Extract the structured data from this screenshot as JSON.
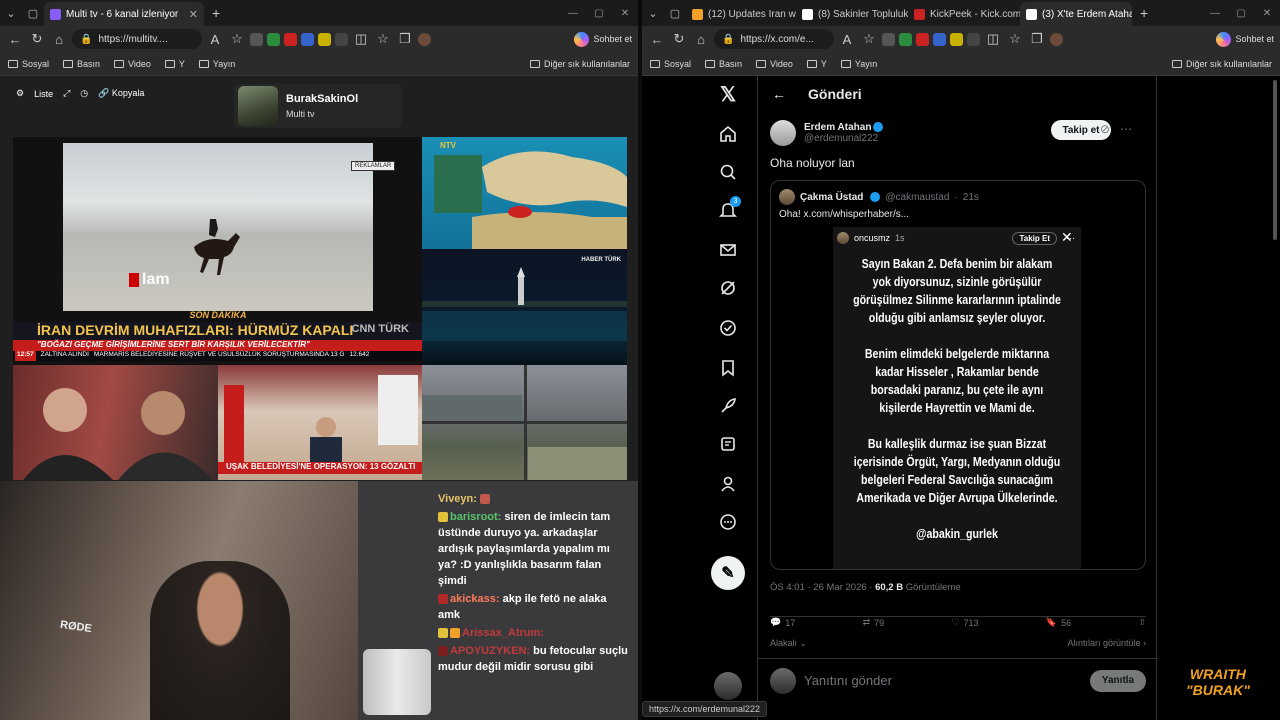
{
  "left_window": {
    "tabs": [
      {
        "label": "Multi tv - 6 kanal izleniyor",
        "active": true
      }
    ],
    "url": "https://multitv....",
    "copilot_label": "Sohbet et",
    "bookmarks": [
      "Sosyal",
      "Basın",
      "Video",
      "Y",
      "Yayın"
    ],
    "bookmarks_right": "Diğer sık kullanılanlar"
  },
  "right_window": {
    "tabs": [
      {
        "label": "(12) Updates Iran wa",
        "active": false
      },
      {
        "label": "(8) Sakinler Topluluk",
        "active": false
      },
      {
        "label": "KickPeek - Kick.com",
        "active": false
      },
      {
        "label": "(3) X'te Erdem Ataha",
        "active": true
      }
    ],
    "url": "https://x.com/e...",
    "copilot_label": "Sohbet et",
    "bookmarks": [
      "Sosyal",
      "Basın",
      "Video",
      "Y",
      "Yayın"
    ],
    "bookmarks_right": "Diğer sık kullanılanlar"
  },
  "multitv": {
    "toolbar": {
      "list": "Liste",
      "copy": "Kopyala"
    },
    "profile": {
      "name": "BurakSakinOl",
      "subtitle": "Multi tv"
    },
    "v1": {
      "ad_badge": "REKLAMLAR",
      "logo": "lam",
      "breaking": "SON DAKİKA",
      "headline": "İRAN DEVRİM MUHAFIZLARI: HÜRMÜZ KAPALI",
      "subhead": "\"BOĞAZI GEÇME GİRİŞİMLERİNE SERT BİR KARŞILIK VERİLECEKTİR\"",
      "time": "12:57",
      "ticker1": "ZALTINA ALINDI",
      "ticker2": "MARMARİS BELEDİYESİNE RÜŞVET VE USULSÜZLÜK SORUŞTURMASINDA 13 G",
      "ticker_value": "12.642",
      "channel": "CNN TÜRK"
    },
    "v2": {
      "channel": "NTV"
    },
    "v3": {
      "channel": "HABER TÜRK"
    },
    "v5": {
      "headline": "UŞAK BELEDİYESİ'NE OPERASYON: 13 GÖZALTI"
    }
  },
  "chat": {
    "messages": [
      {
        "user": "Viveyn:",
        "text": ""
      },
      {
        "user": "barisroot:",
        "text": "siren de imlecin tam üstünde duruyo ya. arkadaşlar ardışık paylaşımlarda yapalım mı ya? :D yanlışlıkla basarım falan şimdi"
      },
      {
        "user": "akickass:",
        "text": "akp ile fetö ne alaka amk"
      },
      {
        "user": "Arissax_Atrum:",
        "text": ""
      },
      {
        "user": "APOYUZYKEN:",
        "text": "bu fetocular suçlu mudur değil midir sorusu gibi"
      }
    ]
  },
  "webcam": {
    "mic_brand": "RØDE"
  },
  "x": {
    "header": "Gönderi",
    "author": {
      "name": "Erdem Atahan",
      "handle": "@erdemunal222"
    },
    "follow_label": "Takip et",
    "text": "Oha noluyor lan",
    "notification_count": "3",
    "quote": {
      "name": "Çakma Üstad",
      "handle": "@cakmaustad",
      "time": "21s",
      "text": "Oha! x.com/whisperhaber/s...",
      "inner": {
        "user": "oncusmz",
        "time": "1s",
        "follow": "Takip Et"
      },
      "story": [
        "Sayın Bakan 2. Defa benim bir alakam yok diyorsunuz, sizinle görüşülür görüşülmez Silinme kararlarının iptalinde olduğu gibi anlamsız şeyler oluyor.",
        "Benim elimdeki belgelerde miktarına kadar Hisseler , Rakamlar bende borsadaki paranız, bu çete ile aynı kişilerde Hayrettin ve Mami de.",
        "Bu kalleşlik durmaz ise şuan Bizzat içerisinde Örgüt, Yargı, Medyanın olduğu belgeleri Federal Savcılığa sunacağım Amerikada ve Diğer Avrupa Ülkelerinde.",
        "@abakin_gurlek"
      ]
    },
    "time": "ÖS 4:01 · 26 Mar 2026 ·",
    "views": "60,2 B",
    "views_label": "Görüntüleme",
    "stats": {
      "replies": "17",
      "reposts": "79",
      "likes": "713",
      "bookmarks": "56"
    },
    "related": "Alakalı",
    "quotes_link": "Alıntıları görüntüle",
    "reply_placeholder": "Yanıtını gönder",
    "reply_button": "Yanıtla"
  },
  "status_url": "https://x.com/erdemunal222",
  "overlay": {
    "line1": "WRAITH",
    "line2": "\"BURAK\""
  }
}
